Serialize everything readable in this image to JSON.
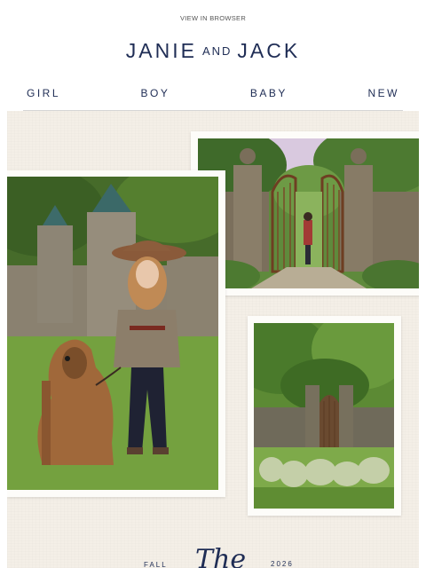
{
  "header": {
    "view_in_browser": "VIEW IN BROWSER",
    "brand_left": "JANIE",
    "brand_and": "AND",
    "brand_right": "JACK"
  },
  "nav": {
    "items": [
      {
        "label": "GIRL"
      },
      {
        "label": "BOY"
      },
      {
        "label": "BABY"
      },
      {
        "label": "NEW"
      }
    ]
  },
  "hero": {
    "background_color": "#f4efe7",
    "caption_left": "FALL",
    "caption_script": "The",
    "caption_right": "2026"
  },
  "colors": {
    "brand_navy": "#1f2d55"
  }
}
